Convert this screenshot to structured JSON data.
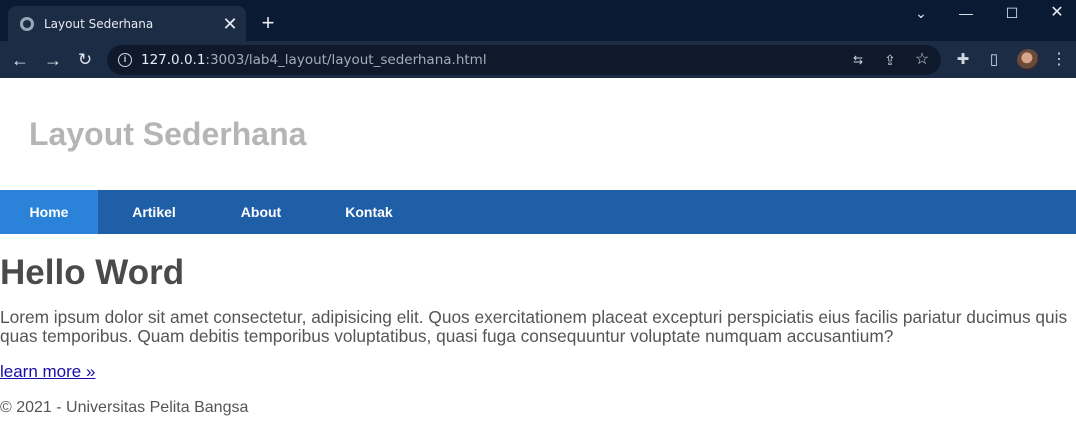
{
  "browser": {
    "tab_title": "Layout Sederhana",
    "tab_close": "✕",
    "new_tab": "+",
    "url_host": "127.0.0.1",
    "url_path": ":3003/lab4_layout/layout_sederhana.html",
    "icons": {
      "back": "←",
      "forward": "→",
      "reload": "↻",
      "info": "i",
      "translate": "⇆",
      "share": "⇪",
      "star": "☆",
      "extensions": "✚",
      "sidepanel": "▯",
      "menu": "⋮",
      "chevron": "⌄",
      "minimize": "—",
      "maximize": "☐",
      "close": "✕"
    }
  },
  "site": {
    "title": "Layout Sederhana",
    "nav": [
      {
        "label": "Home",
        "active": true
      },
      {
        "label": "Artikel",
        "active": false
      },
      {
        "label": "About",
        "active": false
      },
      {
        "label": "Kontak",
        "active": false
      }
    ],
    "colors": {
      "nav_bg": "#1f5fa8",
      "nav_active": "#2b83d9",
      "title": "#b5b5b5"
    }
  },
  "main": {
    "heading": "Hello Word",
    "paragraph": "Lorem ipsum dolor sit amet consectetur, adipisicing elit. Quos exercitationem placeat excepturi perspiciatis eius facilis pariatur ducimus quis quas temporibus. Quam debitis temporibus voluptatibus, quasi fuga consequuntur voluptate numquam accusantium?",
    "link": "learn more »"
  },
  "footer": {
    "text": "© 2021 - Universitas Pelita Bangsa"
  }
}
